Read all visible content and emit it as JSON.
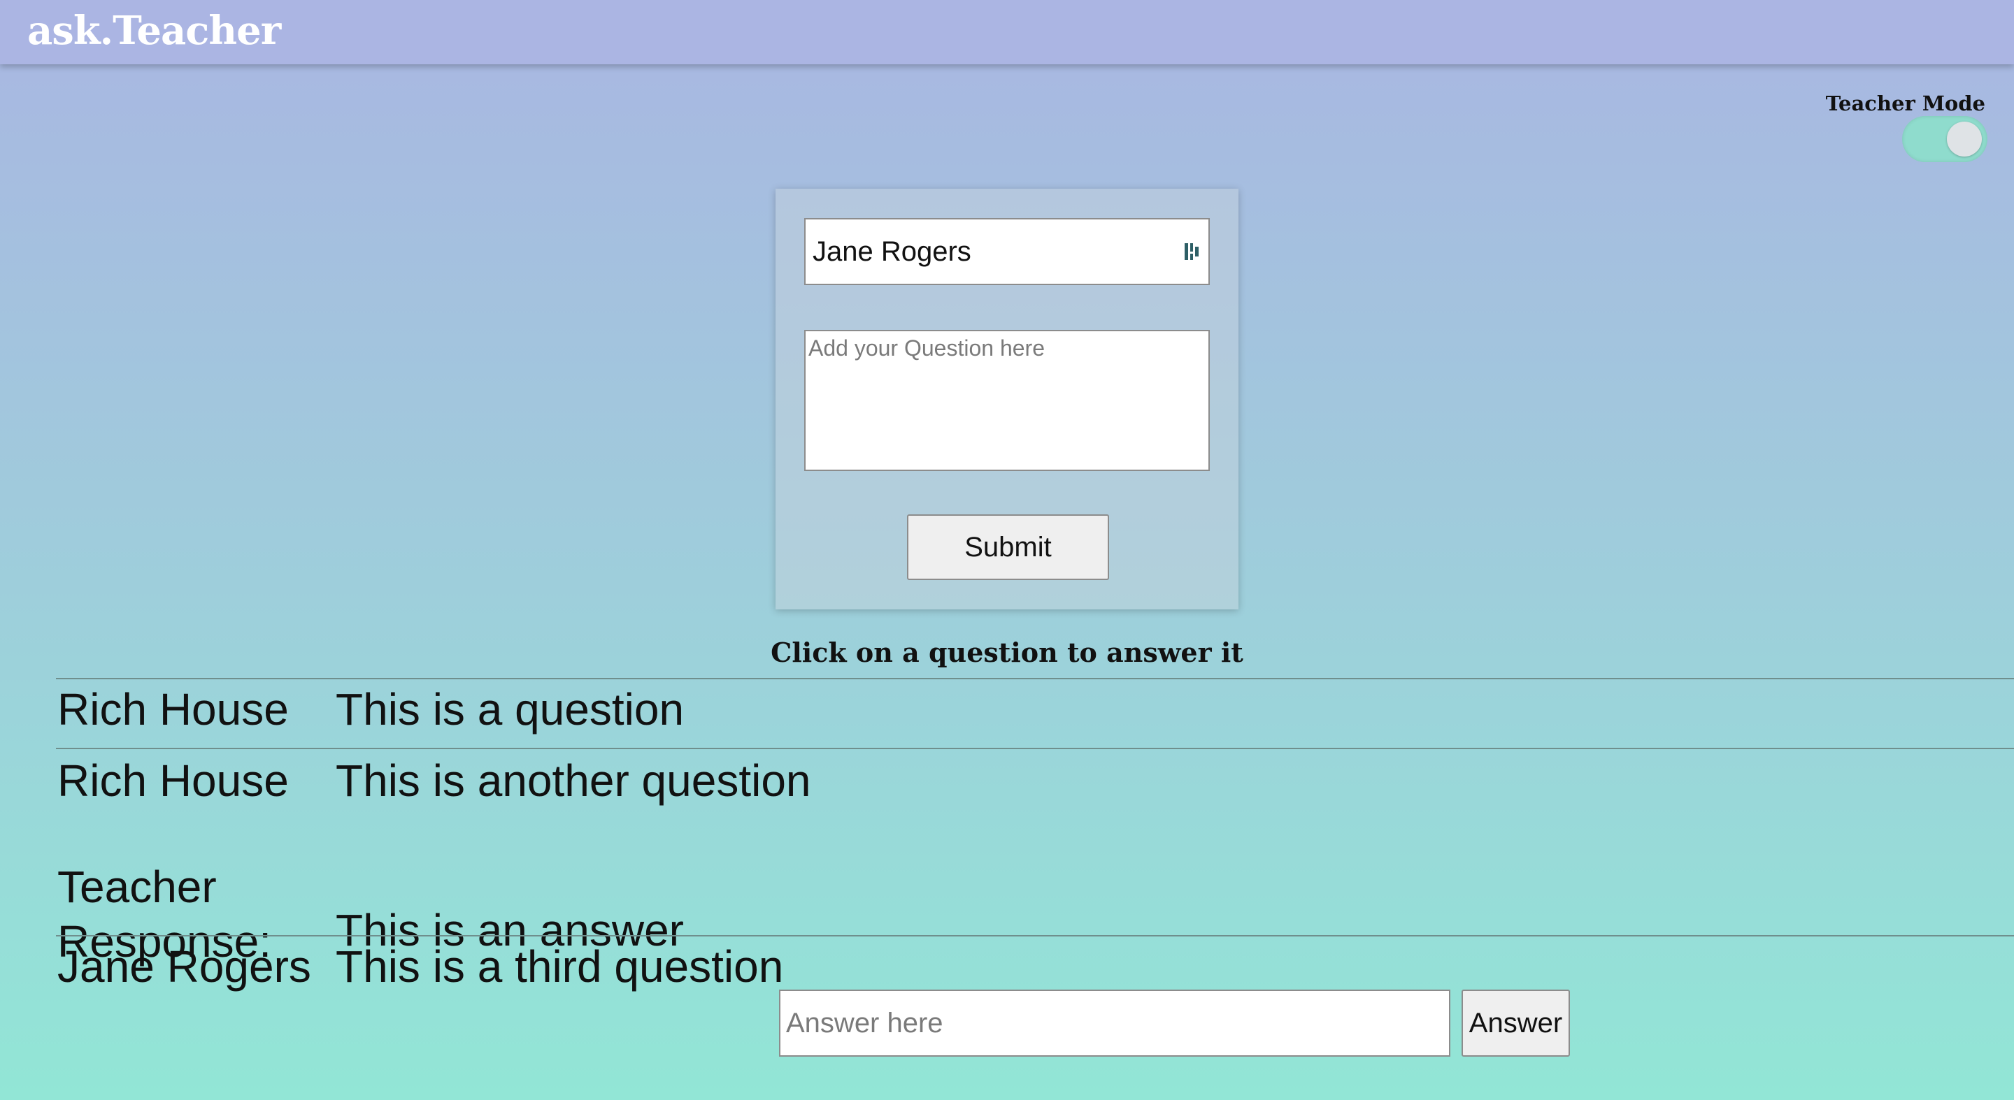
{
  "header": {
    "brand": "ask.Teacher"
  },
  "teacher_mode": {
    "label": "Teacher Mode",
    "enabled": true
  },
  "form": {
    "name_value": "Jane Rogers",
    "question_placeholder": "Add your Question here",
    "submit_label": "Submit"
  },
  "instruction": "Click on a question to answer it",
  "questions": [
    {
      "author": "Rich House",
      "text": "This is a question"
    },
    {
      "author": "Rich House",
      "text": "This is another question"
    },
    {
      "author": "Teacher Response:",
      "text": "This is an answer"
    },
    {
      "author": "Jane Rogers",
      "text": "This is a third question"
    }
  ],
  "answer": {
    "placeholder": "Answer here",
    "button_label": "Answer"
  },
  "colors": {
    "header": "#abb5e3",
    "toggle_on": "#8fdccd",
    "gradient_top": "#a9b6e2",
    "gradient_bottom": "#92e6d6"
  },
  "icons": {
    "name_field_icon": "contact-card-icon"
  }
}
